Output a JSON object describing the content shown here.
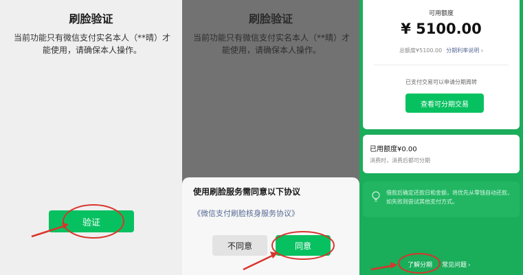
{
  "panel1": {
    "title": "刷脸验证",
    "description": "当前功能只有微信支付实名本人（**晴）才能使用，请确保本人操作。",
    "verify_button": "验证"
  },
  "panel2": {
    "title": "刷脸验证",
    "description": "当前功能只有微信支付实名本人（**晴）才能使用，请确保本人操作。",
    "sheet_title": "使用刷脸服务需同意以下协议",
    "agreement_link": "《微信支付刷脸核身服务协议》",
    "disagree_button": "不同意",
    "agree_button": "同意"
  },
  "panel3": {
    "available_label": "可用额度",
    "available_amount": "¥ 5100.00",
    "total_label": "总额度¥5100.00",
    "rate_link": "分期利率说明 ›",
    "paid_tip": "已支付交易可以申请分期周转",
    "view_button": "查看可分期交易",
    "used_label": "已用额度¥0.00",
    "used_sub": "消费时，消费后都可分期",
    "tip_text": "借款后确定还款日和金额，将优先从零钱自动还款，如失败则尝试其他支付方式。",
    "learn_link": "了解分期",
    "faq_link": "常见问题",
    "faq_chevron": "›"
  },
  "colors": {
    "brand_green": "#07c160",
    "annotation_red": "#d9342b",
    "link_blue": "#576b95"
  }
}
